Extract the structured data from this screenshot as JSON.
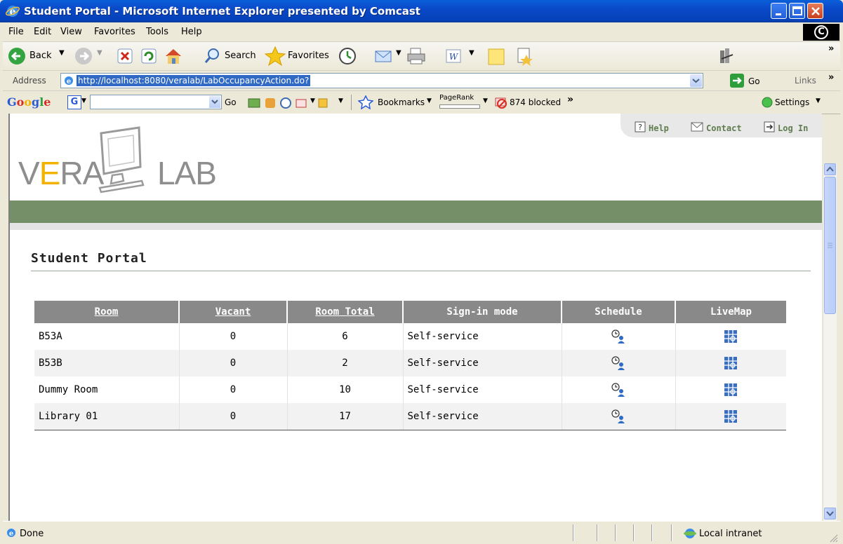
{
  "window": {
    "title": "Student Portal - Microsoft Internet Explorer presented by Comcast"
  },
  "menu": {
    "items": [
      "File",
      "Edit",
      "View",
      "Favorites",
      "Tools",
      "Help"
    ]
  },
  "toolbar": {
    "back_label": "Back",
    "search_label": "Search",
    "favorites_label": "Favorites"
  },
  "address": {
    "label": "Address",
    "url": "http://localhost:8080/veralab/LabOccupancyAction.do?",
    "go_label": "Go",
    "links_label": "Links"
  },
  "google_bar": {
    "go_label": "Go",
    "bookmarks_label": "Bookmarks",
    "pagerank_label": "PageRank",
    "blocked_label": "874 blocked",
    "settings_label": "Settings"
  },
  "page": {
    "header_links": {
      "help": "Help",
      "contact": "Contact",
      "login": "Log In"
    },
    "logo": {
      "text_v": "V",
      "text_e": "E",
      "text_ra": "RA",
      "text_lab": "LAB",
      "accent_color": "#f2b300"
    },
    "section_title": "Student Portal",
    "table": {
      "columns": [
        "Room",
        "Vacant",
        "Room Total",
        "Sign-in mode",
        "Schedule",
        "LiveMap"
      ],
      "rows": [
        {
          "room": "B53A",
          "vacant": "0",
          "total": "6",
          "mode": "Self-service"
        },
        {
          "room": "B53B",
          "vacant": "0",
          "total": "2",
          "mode": "Self-service"
        },
        {
          "room": "Dummy Room",
          "vacant": "0",
          "total": "10",
          "mode": "Self-service"
        },
        {
          "room": "Library 01",
          "vacant": "0",
          "total": "17",
          "mode": "Self-service"
        }
      ]
    }
  },
  "status": {
    "text": "Done",
    "zone": "Local intranet"
  },
  "colors": {
    "titlebar": "#0a49c8",
    "green_band": "#758f68",
    "table_header": "#898989",
    "link_green": "#5f7d4f"
  }
}
